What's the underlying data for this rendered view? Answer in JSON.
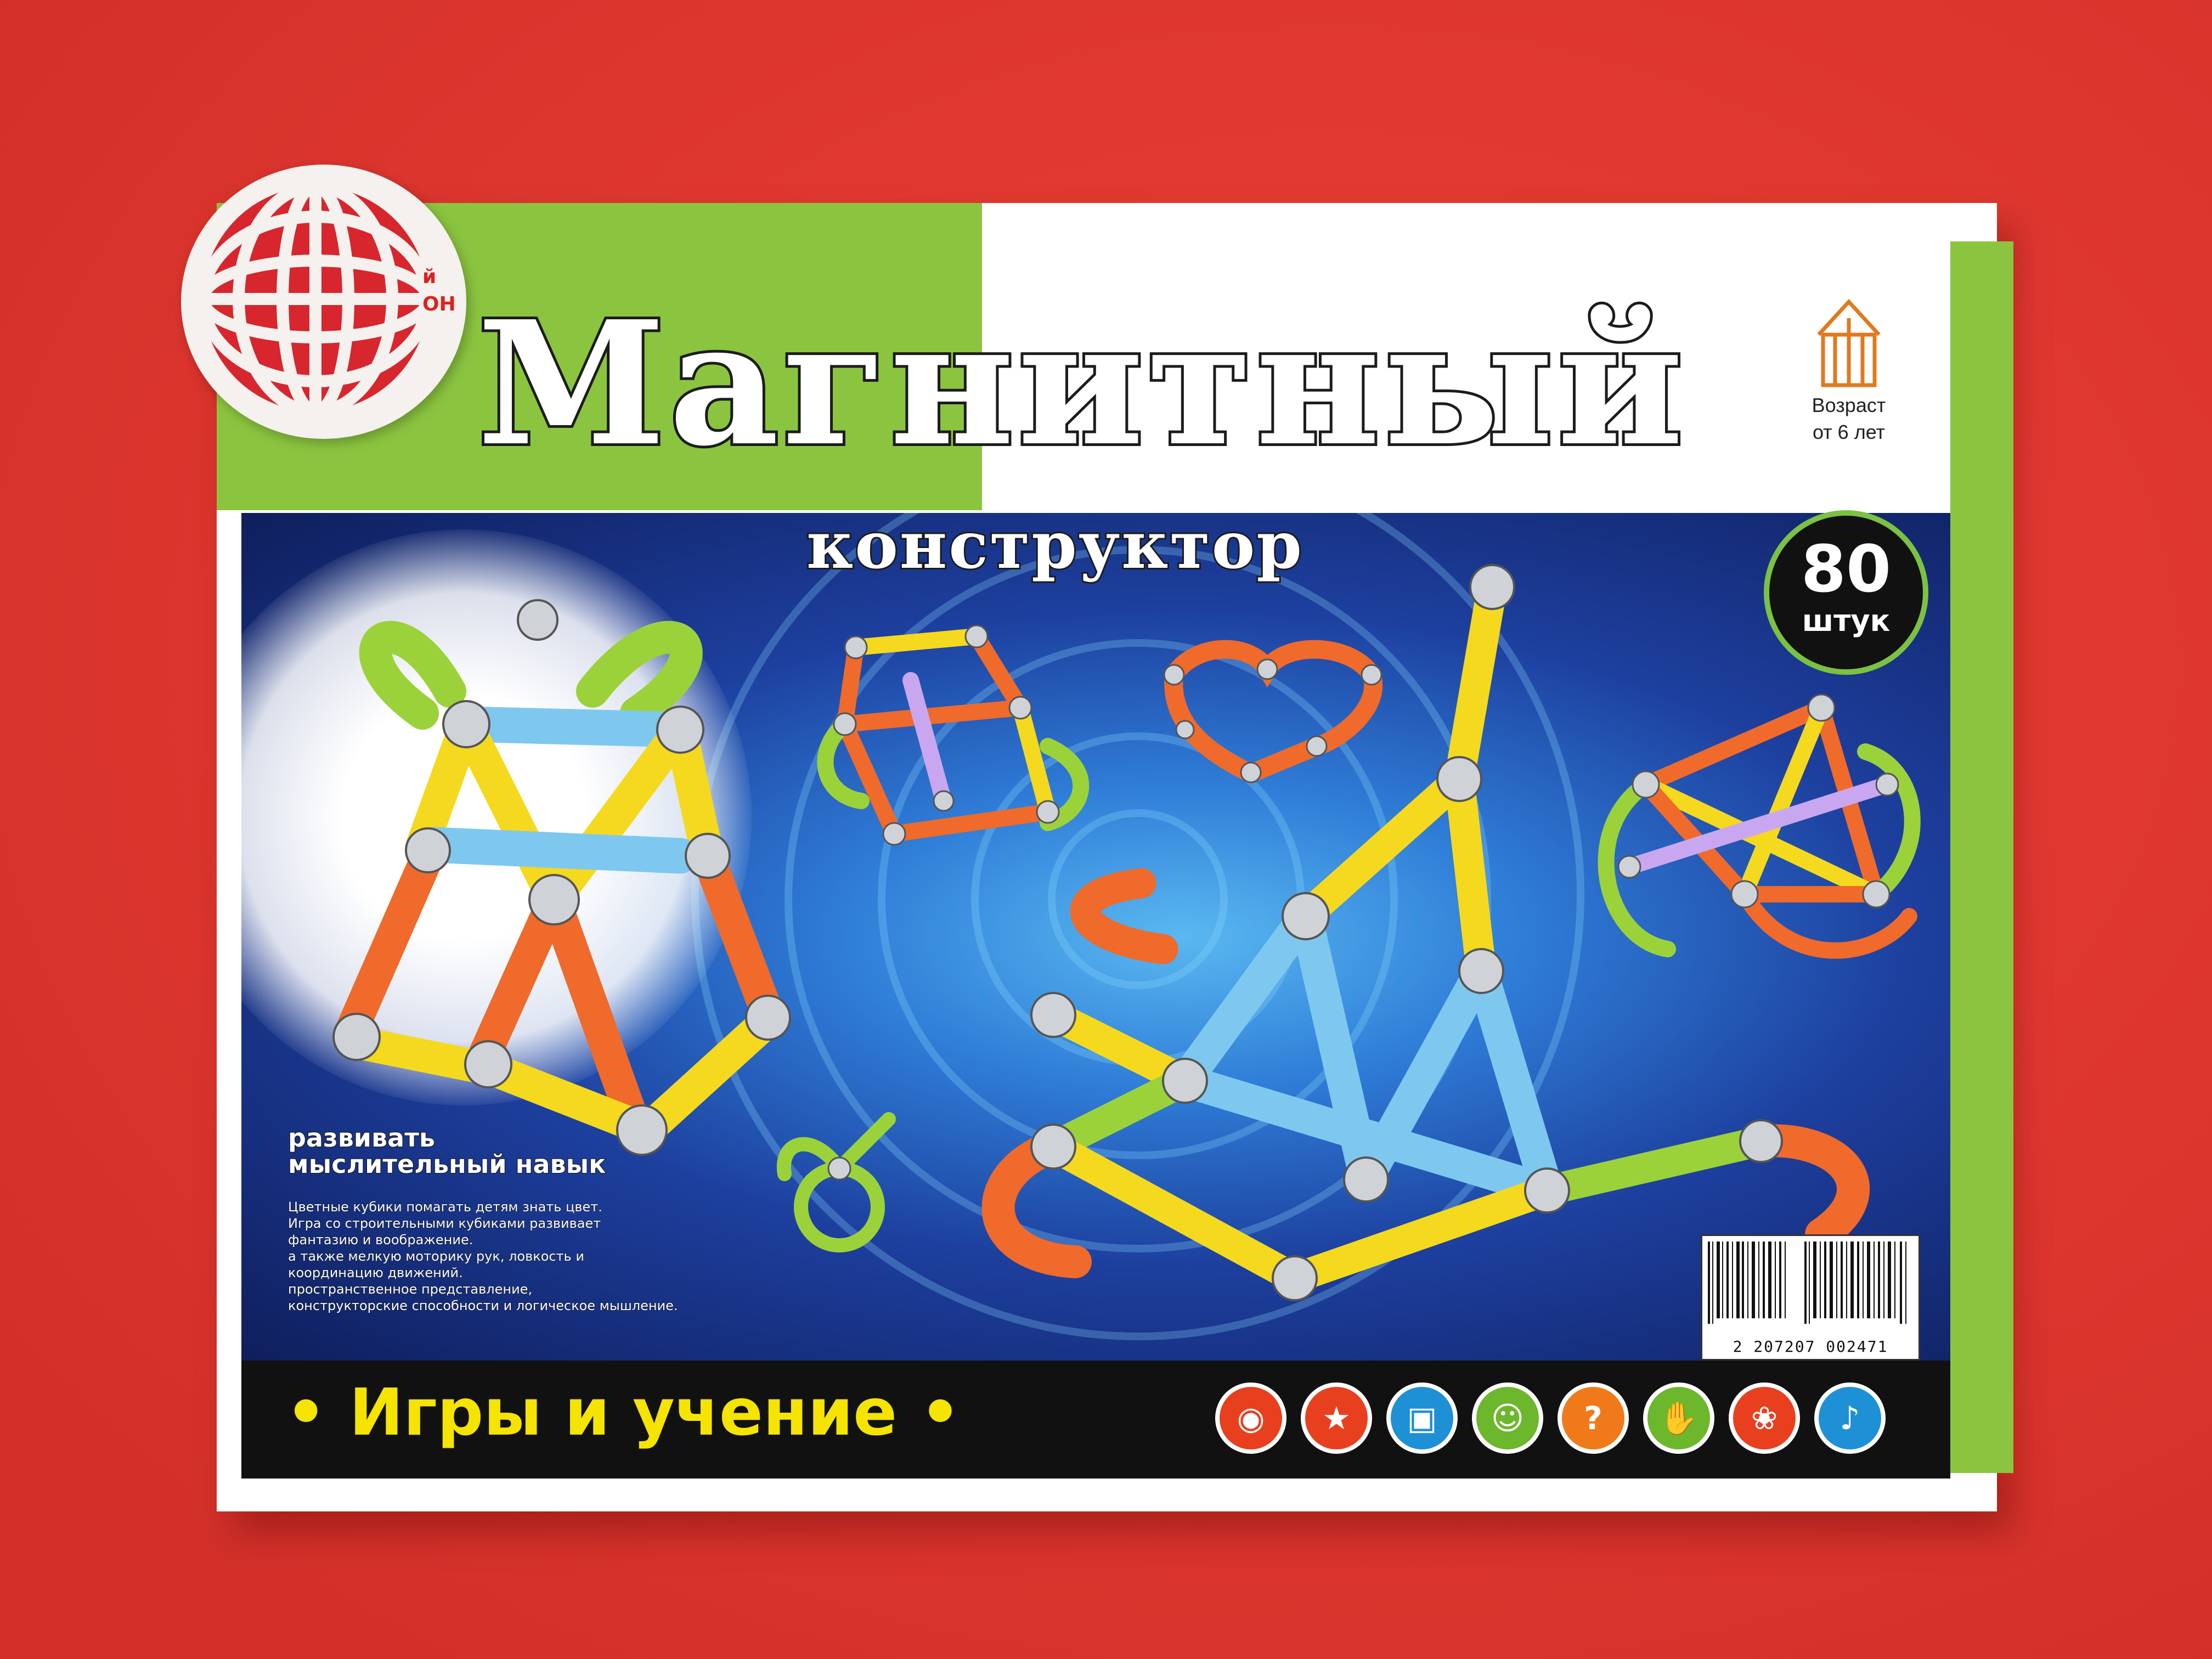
{
  "photo": {
    "background_color": "#e63a32",
    "box_accent_green": "#8bc53f",
    "panel_blue": "#1d3f9e"
  },
  "box": {
    "title": "Магнитный",
    "subtitle": "конструктор",
    "brand_sticker_text": [
      "й",
      "ОН"
    ],
    "age_label": [
      "Возраст",
      "от 6 лет"
    ],
    "pieces_badge": {
      "count": "80",
      "unit": "штук"
    },
    "description_heading": [
      "развивать",
      "мыслительный навык"
    ],
    "description_lines": [
      "Цветные кубики помагать детям знать цвет.",
      "Игра со строительными кубиками развивает",
      "фантазию и воображение.",
      "а также мелкую моторику рук, ловкость и",
      "координацию движений.",
      "пространственное представление,",
      "конструкторские способности и логическое мышление."
    ],
    "slogan": "Игры и учение",
    "barcode_number": "2 207207 002471",
    "skill_icons": [
      {
        "icon": "eye-hand-icon",
        "color": "#e8401f"
      },
      {
        "icon": "shapes-icon",
        "color": "#e8401f"
      },
      {
        "icon": "puzzle-icon",
        "color": "#1e90d6"
      },
      {
        "icon": "face-icon",
        "color": "#6cb72c"
      },
      {
        "icon": "question-head-icon",
        "color": "#f07a1a"
      },
      {
        "icon": "hand-icon",
        "color": "#6cb72c"
      },
      {
        "icon": "brain-icon",
        "color": "#e8401f"
      },
      {
        "icon": "microphone-icon",
        "color": "#1e90d6"
      }
    ]
  }
}
